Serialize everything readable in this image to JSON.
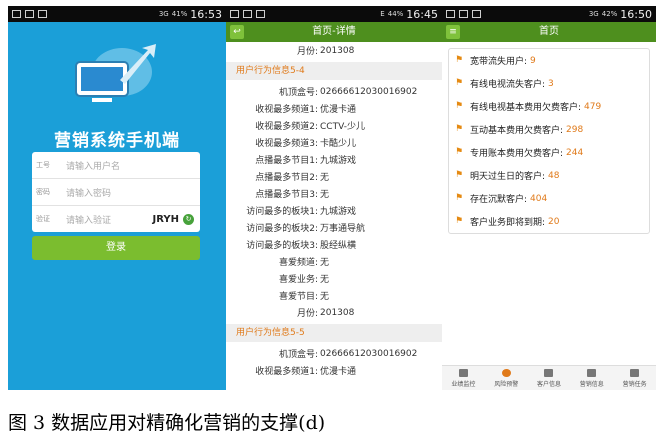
{
  "phone1": {
    "status": {
      "battery": "41%",
      "time": "16:53",
      "network": "3G"
    },
    "app_title": "营销系统手机端",
    "fields": [
      {
        "label": "工号",
        "placeholder": "请输入用户名"
      },
      {
        "label": "密码",
        "placeholder": "请输入密码"
      },
      {
        "label": "验证",
        "placeholder": "请输入验证"
      }
    ],
    "captcha": "JRYH",
    "login_label": "登录"
  },
  "phone2": {
    "status": {
      "battery": "44%",
      "time": "16:45",
      "network": "E"
    },
    "title": "首页-详情",
    "rows_top": [
      {
        "label": "月份:",
        "value": "201308"
      }
    ],
    "section1": "用户行为信息5-4",
    "rows1": [
      {
        "label": "机顶盒号:",
        "value": "02666612030016902"
      },
      {
        "label": "收视最多频道1:",
        "value": "优漫卡通"
      },
      {
        "label": "收视最多频道2:",
        "value": "CCTV-少儿"
      },
      {
        "label": "收视最多频道3:",
        "value": "卡酷少儿"
      },
      {
        "label": "点播最多节目1:",
        "value": "九城游戏"
      },
      {
        "label": "点播最多节目2:",
        "value": "无"
      },
      {
        "label": "点播最多节目3:",
        "value": "无"
      },
      {
        "label": "访问最多的板块1:",
        "value": "九城游戏"
      },
      {
        "label": "访问最多的板块2:",
        "value": "万事通导航"
      },
      {
        "label": "访问最多的板块3:",
        "value": "股经纵横"
      },
      {
        "label": "喜爱频道:",
        "value": "无"
      },
      {
        "label": "喜爱业务:",
        "value": "无"
      },
      {
        "label": "喜爱节目:",
        "value": "无"
      },
      {
        "label": "月份:",
        "value": "201308"
      }
    ],
    "section2": "用户行为信息5-5",
    "rows2": [
      {
        "label": "机顶盒号:",
        "value": "02666612030016902"
      },
      {
        "label": "收视最多频道1:",
        "value": "优漫卡通"
      }
    ]
  },
  "phone3": {
    "status": {
      "battery": "42%",
      "time": "16:50",
      "network": "3G"
    },
    "title": "首页",
    "items": [
      {
        "label": "宽带流失用户:",
        "value": "9"
      },
      {
        "label": "有线电视流失客户:",
        "value": "3"
      },
      {
        "label": "有线电视基本费用欠费客户:",
        "value": "479"
      },
      {
        "label": "互动基本费用欠费客户:",
        "value": "298"
      },
      {
        "label": "专用账本费用欠费客户:",
        "value": "244"
      },
      {
        "label": "明天过生日的客户:",
        "value": "48"
      },
      {
        "label": "存在沉默客户:",
        "value": "404"
      },
      {
        "label": "客户业务即将到期:",
        "value": "20"
      }
    ],
    "nav": [
      "业绩监控",
      "风险预警",
      "客户信息",
      "营销信息",
      "营销任务"
    ]
  },
  "caption": "图 3  数据应用对精确化营销的支撑(d)"
}
